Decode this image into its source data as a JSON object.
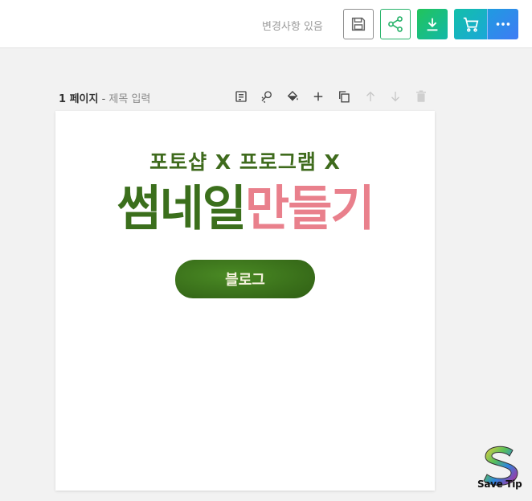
{
  "toolbar": {
    "status": "변경사항 있음",
    "buttons": [
      {
        "icon": "save-icon",
        "color": "#8f8f8f"
      },
      {
        "icon": "share-icon",
        "color": "#29b36b"
      },
      {
        "icon": "download-icon",
        "color": "#22c45a"
      },
      {
        "icon": "cart-icon",
        "color": "#13bfa9"
      },
      {
        "icon": "more-icon",
        "color": "#3f7bf5"
      }
    ]
  },
  "page_header": {
    "page_number": "1 페이지",
    "separator": " - ",
    "title_placeholder": "제목 입력",
    "tools": [
      "memo-icon",
      "magic-icon",
      "fill-icon",
      "add-page-icon",
      "duplicate-icon",
      "move-up-icon",
      "move-down-icon",
      "delete-icon"
    ]
  },
  "canvas": {
    "subtitle": "포토샵 X 프로그램 X",
    "headline_green": "썸네일",
    "headline_pink": "만들기",
    "badge": "블로그",
    "colors": {
      "green": "#3b6f1c",
      "pink": "#e9808c",
      "badge": "#3b7a1c"
    }
  },
  "watermark": {
    "text": "Save Tip"
  }
}
